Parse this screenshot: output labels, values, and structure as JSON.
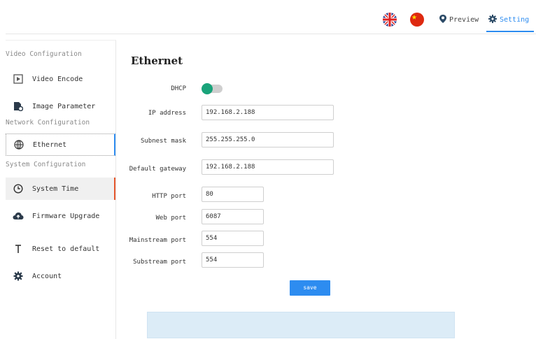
{
  "header": {
    "preview_label": "Preview",
    "setting_label": "Setting",
    "uk_flag_icon": "uk-flag-icon",
    "cn_flag_icon": "china-flag-icon"
  },
  "sidebar": {
    "groups": [
      {
        "title": "Video Configuration"
      },
      {
        "title": "Network Configuration"
      },
      {
        "title": "System Configuration"
      }
    ],
    "items": [
      {
        "label": "Video Encode",
        "icon": "video-icon"
      },
      {
        "label": "Image Parameter",
        "icon": "image-settings-icon"
      },
      {
        "label": "Ethernet",
        "icon": "globe-icon"
      },
      {
        "label": "System Time",
        "icon": "clock-icon"
      },
      {
        "label": "Firmware Upgrade",
        "icon": "cloud-upload-icon"
      },
      {
        "label": "Reset to default",
        "icon": "reset-icon"
      },
      {
        "label": "Account",
        "icon": "gear-icon"
      }
    ]
  },
  "main": {
    "title": "Ethernet",
    "fields": {
      "dhcp": {
        "label": "DHCP",
        "on": true
      },
      "ip": {
        "label": "IP address",
        "value": "192.168.2.188"
      },
      "subnet": {
        "label": "Subnest mask",
        "value": "255.255.255.0"
      },
      "gateway": {
        "label": "Default gateway",
        "value": "192.168.2.188"
      },
      "http": {
        "label": "HTTP port",
        "value": "80"
      },
      "web": {
        "label": "Web port",
        "value": "6087"
      },
      "mainstream": {
        "label": "Mainstream port",
        "value": "554"
      },
      "substream": {
        "label": "Substream port",
        "value": "554"
      }
    },
    "save_label": "save"
  },
  "colors": {
    "accent": "#2d8cf0",
    "toggle_on": "#19a37a",
    "active_marker": "#e5572c",
    "info_box": "#dcecf7"
  }
}
